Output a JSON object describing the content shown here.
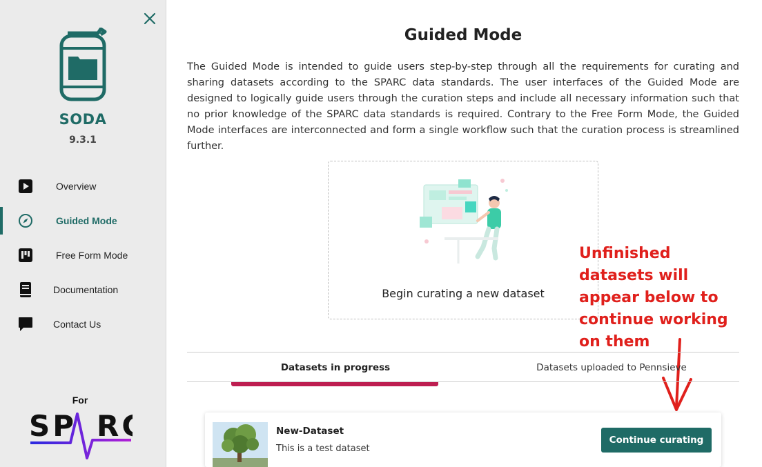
{
  "sidebar": {
    "app_name": "SODA",
    "version": "9.3.1",
    "items": [
      {
        "label": "Overview",
        "icon": "play-icon",
        "active": false
      },
      {
        "label": "Guided Mode",
        "icon": "compass-icon",
        "active": true
      },
      {
        "label": "Free Form Mode",
        "icon": "board-icon",
        "active": false
      },
      {
        "label": "Documentation",
        "icon": "book-icon",
        "active": false
      },
      {
        "label": "Contact Us",
        "icon": "chat-icon",
        "active": false
      }
    ],
    "for_label": "For",
    "sparc_logo_text": "SPARC"
  },
  "main": {
    "title": "Guided Mode",
    "intro": "The Guided Mode is intended to guide users step-by-step through all the requirements for curating and sharing datasets according to the SPARC data standards. The user interfaces of the Guided Mode are designed to logically guide users through the curation steps and include all necessary information such that no prior knowledge of the SPARC data standards is required. Contrary to the Free Form Mode, the Guided Mode interfaces are interconnected and form a single workflow such that the curation process is streamlined further.",
    "new_dataset_label": "Begin curating a new dataset",
    "tabs": [
      {
        "label": "Datasets in progress",
        "active": true
      },
      {
        "label": "Datasets uploaded to Pennsieve",
        "active": false
      }
    ],
    "datasets": [
      {
        "name": "New-Dataset",
        "description": "This is a test dataset",
        "button_label": "Continue curating"
      }
    ]
  },
  "annotation": {
    "lines": [
      "Unfinished",
      "datasets will",
      "appear below to",
      "continue working",
      "on them"
    ]
  },
  "colors": {
    "accent": "#1f6b66",
    "tab_underline": "#bd1e51",
    "annotation": "#e0201c",
    "sidebar_bg": "#ebebeb"
  }
}
